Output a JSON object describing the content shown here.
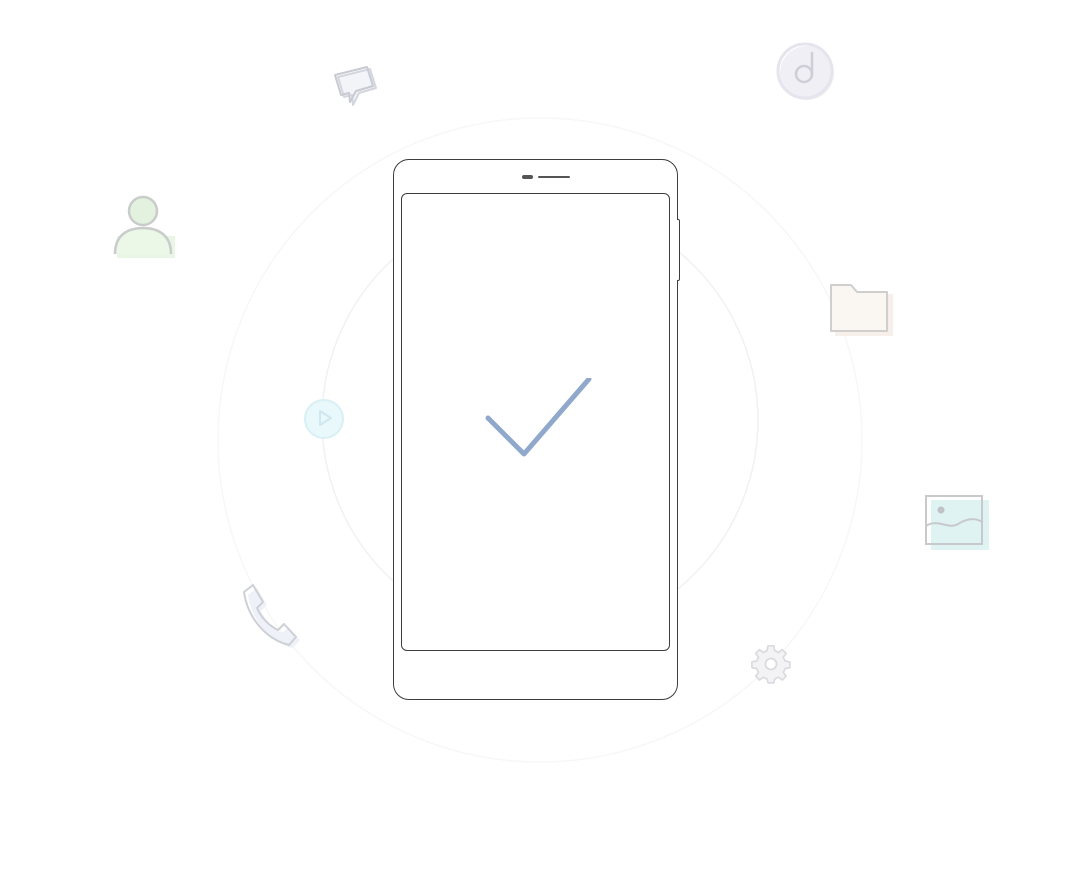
{
  "screen": {
    "status": "success",
    "colors": {
      "checkmark": "#8fa8cb",
      "phone_outline": "#3d3d3d",
      "phone_notch": "#555555",
      "contact_fill": "#e9f6e6",
      "folder_fill": "#f7f0ea",
      "image_fill": "#def3f2",
      "video_fill": "#e8f8fb",
      "music_fill": "#f0eff5",
      "phone_icon_fill": "#ecf0f6",
      "icon_stroke": "#c9c9cf",
      "background": "#ffffff"
    }
  },
  "phone": {
    "screen_icon": "checkmark-icon"
  },
  "floating_icons": [
    {
      "icon": "message-icon"
    },
    {
      "icon": "music-icon"
    },
    {
      "icon": "contact-icon"
    },
    {
      "icon": "folder-icon"
    },
    {
      "icon": "video-icon"
    },
    {
      "icon": "image-icon"
    },
    {
      "icon": "call-icon"
    },
    {
      "icon": "settings-icon"
    }
  ]
}
